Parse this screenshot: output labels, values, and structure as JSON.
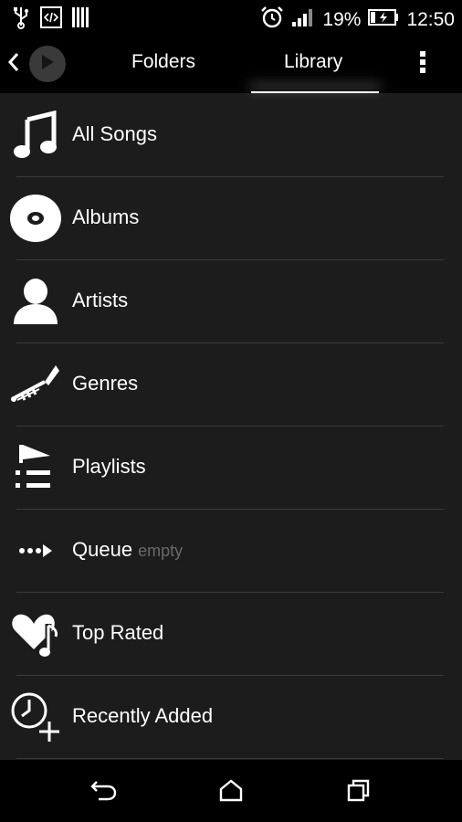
{
  "status_bar": {
    "battery_percent": "19%",
    "time": "12:50"
  },
  "top_bar": {
    "tabs": [
      {
        "label": "Folders"
      },
      {
        "label": "Library"
      }
    ],
    "selected_tab": "Library"
  },
  "library": {
    "items": [
      {
        "label": "All Songs",
        "icon": "music-note-icon",
        "sub": ""
      },
      {
        "label": "Albums",
        "icon": "disc-icon",
        "sub": ""
      },
      {
        "label": "Artists",
        "icon": "person-icon",
        "sub": ""
      },
      {
        "label": "Genres",
        "icon": "trumpet-icon",
        "sub": ""
      },
      {
        "label": "Playlists",
        "icon": "playlist-icon",
        "sub": ""
      },
      {
        "label": "Queue",
        "icon": "queue-icon",
        "sub": "empty"
      },
      {
        "label": "Top Rated",
        "icon": "heart-note-icon",
        "sub": ""
      },
      {
        "label": "Recently Added",
        "icon": "clock-plus-icon",
        "sub": ""
      }
    ]
  },
  "colors": {
    "background": "#1c1c1c",
    "bar": "#000000",
    "divider": "#3a3a3a",
    "text": "#ffffff",
    "subtext": "#6a6a6a"
  }
}
